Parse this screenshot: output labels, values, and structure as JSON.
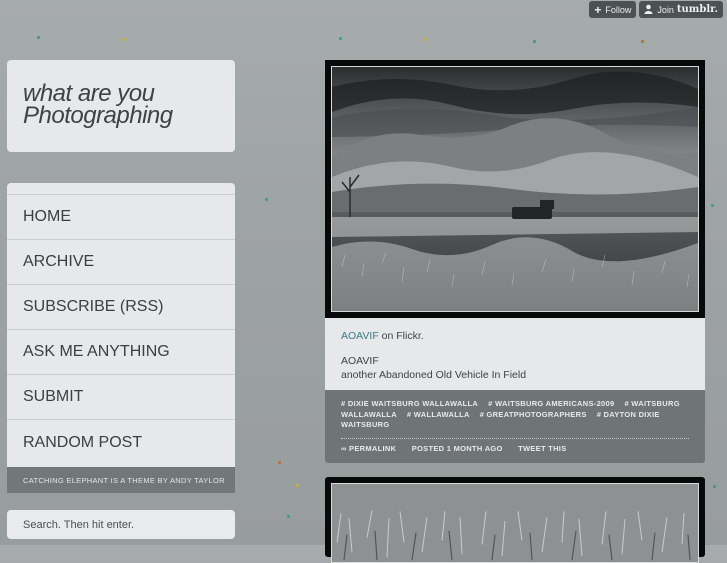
{
  "tumblr": {
    "follow_label": "Follow",
    "join_label": "Join",
    "brand": "tumblr."
  },
  "blog": {
    "title_line1": "what are you",
    "title_line2": "Photographing"
  },
  "nav": {
    "items": [
      {
        "label": "HOME"
      },
      {
        "label": "ARCHIVE"
      },
      {
        "label": "SUBSCRIBE (RSS)"
      },
      {
        "label": "ASK ME ANYTHING"
      },
      {
        "label": "SUBMIT"
      },
      {
        "label": "RANDOM POST"
      }
    ],
    "footer": "CATCHING ELEPHANT IS A THEME BY ANDY TAYLOR"
  },
  "search": {
    "placeholder": "Search. Then hit enter."
  },
  "post": {
    "source_link": "AOAVIF",
    "source_suffix": " on Flickr.",
    "title": "AOAVIF",
    "description": "another Abandoned Old Vehicle In Field",
    "tags": [
      "# DIXIE WAITSBURG WALLAWALLA",
      "# WAITSBURG AMERICANS-2009",
      "# WAITSBURG WALLAWALLA",
      "# WALLAWALLA",
      "# GREATPHOTOGRAPHERS",
      "# DAYTON DIXIE WAITSBURG"
    ],
    "permalink": "∞ PERMALINK",
    "posted": "POSTED 1 MONTH AGO",
    "tweet": "TWEET THIS"
  },
  "colors": {
    "background": "#9ea3a4",
    "panel": "#e6e8e9",
    "link": "#3a7d86",
    "meta_bg": "#6f7475"
  }
}
